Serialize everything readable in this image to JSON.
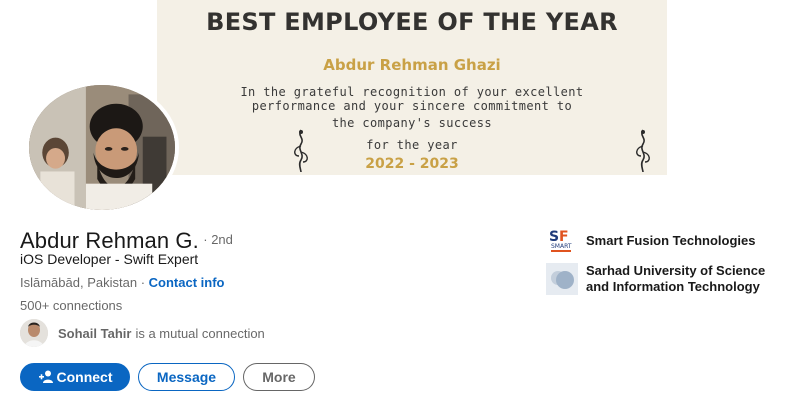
{
  "banner": {
    "certificate_title": "BEST EMPLOYEE OF THE YEAR",
    "certificate_name": "Abdur Rehman Ghazi",
    "certificate_lines": [
      "In the grateful recognition of your excellent",
      "performance and your sincere commitment to",
      "the company's success",
      "for the year"
    ],
    "certificate_years": "2022 - 2023"
  },
  "profile": {
    "name": "Abdur Rehman G.",
    "degree": "· 2nd",
    "headline": "iOS Developer - Swift Expert",
    "location": "Islāmābād, Pakistan",
    "separator": " · ",
    "contact_info_label": "Contact info",
    "connections": "500+ connections"
  },
  "mutual": {
    "name": "Sohail Tahir",
    "text": "is a mutual connection"
  },
  "actions": {
    "connect_label": "Connect",
    "message_label": "Message",
    "more_label": "More"
  },
  "organizations": [
    {
      "name": "Smart Fusion Technologies",
      "logo": "smart-fusion-logo",
      "logo_text": "SMART"
    },
    {
      "name_line1": "Sarhad University of Science",
      "name_line2": "and Information Technology",
      "logo": "sarhad-university-logo"
    }
  ],
  "colors": {
    "accent": "#0a66c2",
    "certificate_gold": "#c9a146",
    "certificate_bg": "#f4f0e6"
  }
}
